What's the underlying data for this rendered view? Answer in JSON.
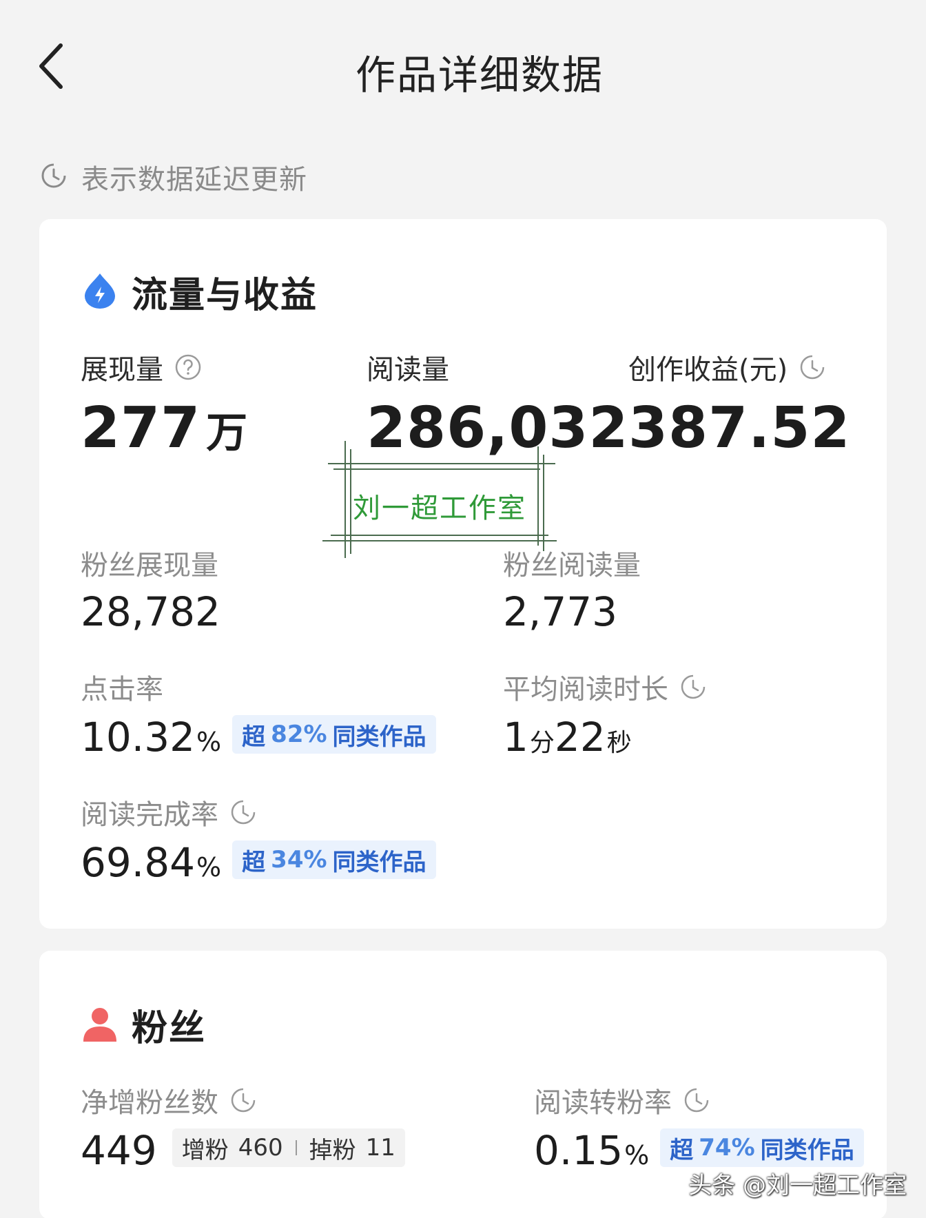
{
  "header": {
    "back_icon": "chevron-left-icon",
    "title": "作品详细数据"
  },
  "notice": {
    "icon": "clock-icon",
    "text": "表示数据延迟更新"
  },
  "traffic": {
    "icon": "lightning-drop-icon",
    "title": "流量与收益",
    "impressions": {
      "label": "展现量",
      "value": "277",
      "unit": "万"
    },
    "reads": {
      "label": "阅读量",
      "value": "286,032"
    },
    "earnings": {
      "label": "创作收益(元)",
      "value": "387.52"
    },
    "fan_impressions": {
      "label": "粉丝展现量",
      "value": "28,782"
    },
    "fan_reads": {
      "label": "粉丝阅读量",
      "value": "2,773"
    },
    "ctr": {
      "label": "点击率",
      "value": "10.32",
      "unit": "%",
      "badge_prefix": "超",
      "badge_pct": "82%",
      "badge_suffix": "同类作品"
    },
    "avg_time": {
      "label": "平均阅读时长",
      "min": "1",
      "min_unit": "分",
      "sec": "22",
      "sec_unit": "秒"
    },
    "completion": {
      "label": "阅读完成率",
      "value": "69.84",
      "unit": "%",
      "badge_prefix": "超",
      "badge_pct": "34%",
      "badge_suffix": "同类作品"
    }
  },
  "fans": {
    "icon": "user-icon",
    "title": "粉丝",
    "net": {
      "label": "净增粉丝数",
      "value": "449",
      "gain_label": "增粉",
      "gain": "460",
      "loss_label": "掉粉",
      "loss": "11"
    },
    "conversion": {
      "label": "阅读转粉率",
      "value": "0.15",
      "unit": "%",
      "badge_prefix": "超",
      "badge_pct": "74%",
      "badge_suffix": "同类作品"
    }
  },
  "watermark": {
    "stamp_text": "刘一超工作室",
    "bottom_text": "头条 @刘一超工作室"
  },
  "colors": {
    "accent_blue": "#2d64c9",
    "badge_bg": "#eaf2fd",
    "fans_icon": "#f06464",
    "stamp_green": "#2f9a38"
  }
}
